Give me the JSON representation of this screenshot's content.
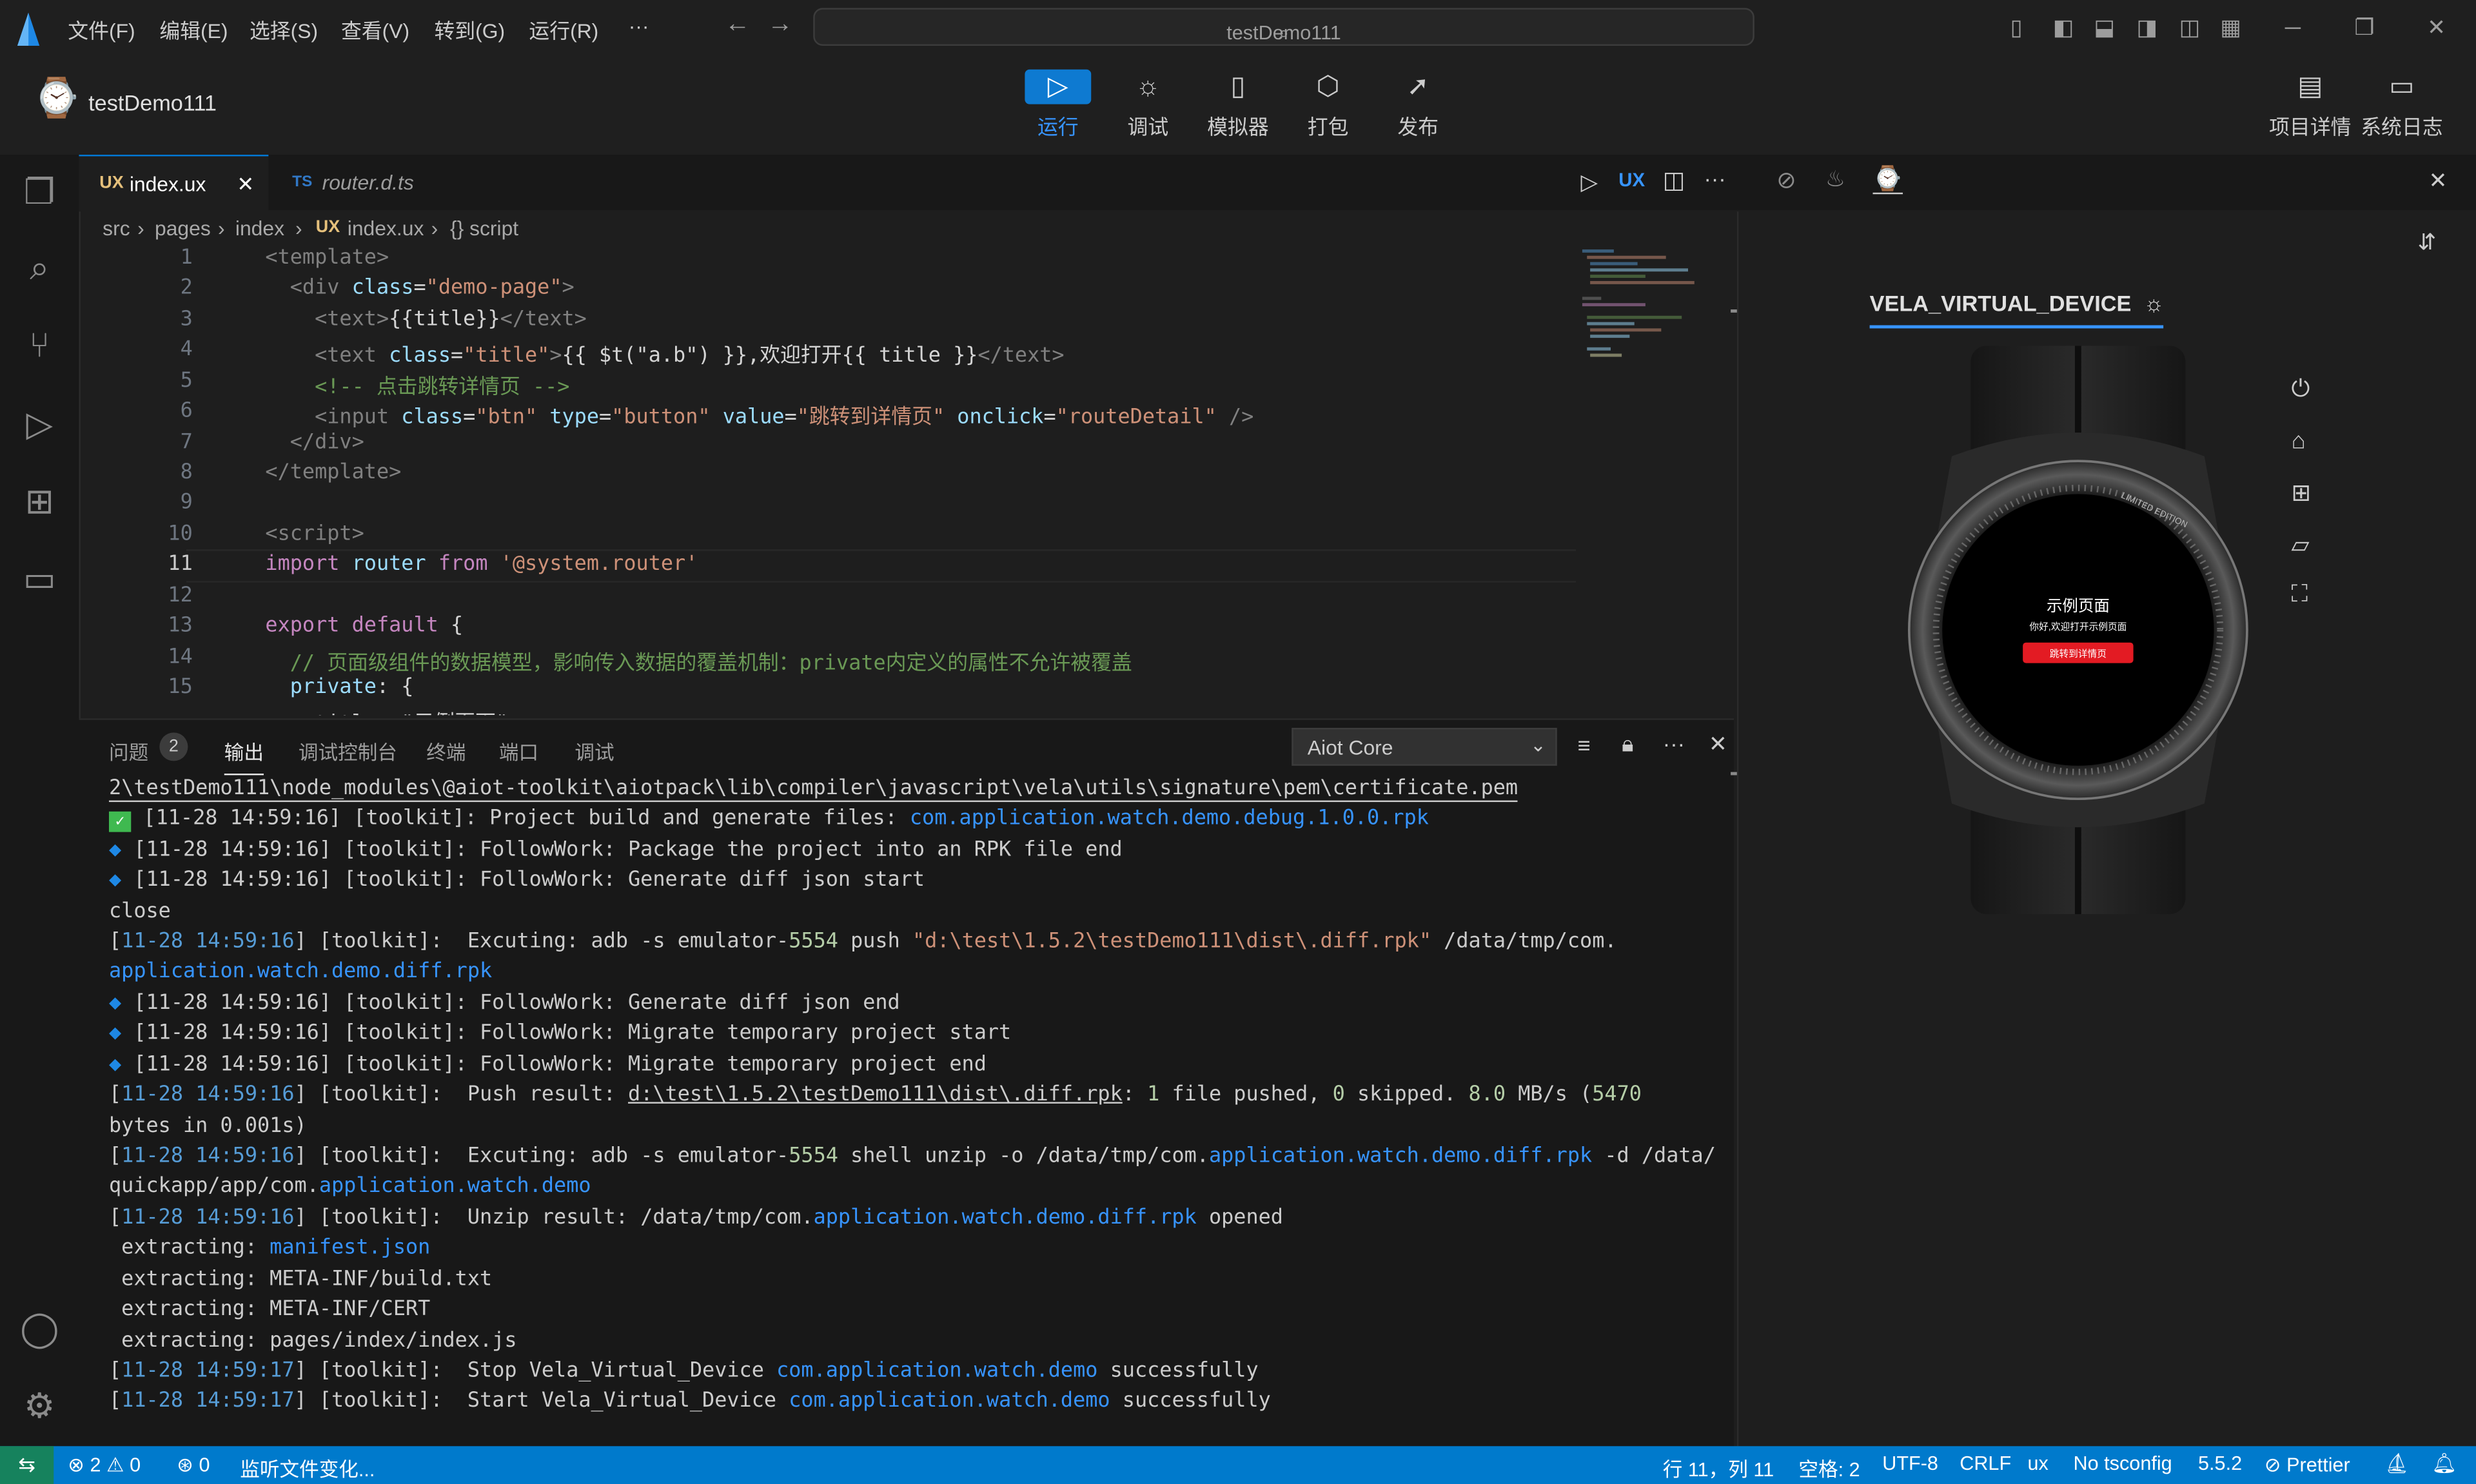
{
  "menu": [
    "文件(F)",
    "编辑(E)",
    "选择(S)",
    "查看(V)",
    "转到(G)",
    "运行(R)",
    "···"
  ],
  "search": {
    "text": "testDemo111"
  },
  "project": {
    "name": "testDemo111"
  },
  "toolbar": {
    "center": [
      {
        "icon": "play-icon",
        "label": "运行"
      },
      {
        "icon": "bug-icon",
        "label": "调试"
      },
      {
        "icon": "phone-icon",
        "label": "模拟器"
      },
      {
        "icon": "package-icon",
        "label": "打包"
      },
      {
        "icon": "send-icon",
        "label": "发布"
      }
    ],
    "right": [
      {
        "icon": "document-icon",
        "label": "项目详情"
      },
      {
        "icon": "folder-icon",
        "label": "系统日志"
      }
    ]
  },
  "tabs": [
    {
      "badge": "UX",
      "label": "index.ux",
      "close": "✕"
    },
    {
      "badge": "TS",
      "label": "router.d.ts"
    }
  ],
  "tab_actions": {
    "ux": "UX"
  },
  "breadcrumb": {
    "p1": "src",
    "p2": "pages",
    "p3": "index",
    "badge": "UX",
    "p4": "index.ux",
    "p5": "{} script"
  },
  "code_lines": [
    "1",
    "2",
    "3",
    "4",
    "5",
    "6",
    "7",
    "8",
    "9",
    "10",
    "11",
    "12",
    "13",
    "14",
    "15"
  ],
  "code": {
    "l1": "<template>",
    "l2a": "  <div ",
    "l2b": "class",
    "l2c": "=",
    "l2d": "\"demo-page\"",
    "l2e": ">",
    "l3a": "    <text>",
    "l3b": "{{title}}",
    "l3c": "</text>",
    "l4a": "    <text ",
    "l4b": "class",
    "l4c": "=",
    "l4d": "\"title\"",
    "l4e": ">",
    "l4f": "{{ $t(\"a.b\") }},欢迎打开{{ title }}",
    "l4g": "</text>",
    "l5": "    <!-- 点击跳转详情页 -->",
    "l6a": "    <input ",
    "l6b": "class",
    "l6d": "\"btn\"",
    "l6e": " type",
    "l6f": "\"button\"",
    "l6g": " value",
    "l6h": "\"跳转到详情页\"",
    "l6i": " onclick",
    "l6j": "\"routeDetail\"",
    "l6k": " />",
    "l7": "  </div>",
    "l8": "</template>",
    "l10": "<script>",
    "l11a": "import",
    "l11b": " router ",
    "l11c": "from",
    "l11d": " '@system.router'",
    "l13a": "export default",
    "l13b": " {",
    "l14": "  // 页面级组件的数据模型，影响传入数据的覆盖机制：private内定义的属性不允许被覆盖",
    "l15a": "  private",
    "l15b": ": {",
    "l16": "    title: \"示例页面\""
  },
  "panel": {
    "tabs": [
      "问题",
      "输出",
      "调试控制台",
      "终端",
      "端口",
      "调试"
    ],
    "problems_count": "2",
    "channel": "Aiot Core",
    "lines": {
      "o1": "2\\testDemo111\\node_modules\\@aiot-toolkit\\aiotpack\\lib\\compiler\\javascript\\vela\\utils\\signature\\pem\\certificate.pem",
      "o2a": " [11-28 14:59:16] [toolkit]: Project build and generate files: ",
      "o2b": "com.application.watch.demo.debug.1.0.0.rpk",
      "o3": " [11-28 14:59:16] [toolkit]: FollowWork: Package the project into an RPK file end",
      "o4": " [11-28 14:59:16] [toolkit]: FollowWork: Generate diff json start",
      "o5": "close",
      "o6a": "[",
      "o6b": "11-28 14:59:16",
      "o6c": "] [toolkit]:  Excuting: adb -s emulator-",
      "o6d": "5554",
      "o6e": " push ",
      "o6f": "\"d:\\test\\1.5.2\\testDemo111\\dist\\.diff.rpk\"",
      "o6g": " /data/tmp/com.",
      "o7": "application.watch.demo.diff.rpk",
      "o8": " [11-28 14:59:16] [toolkit]: FollowWork: Generate diff json end",
      "o9": " [11-28 14:59:16] [toolkit]: FollowWork: Migrate temporary project start",
      "o10": " [11-28 14:59:16] [toolkit]: FollowWork: Migrate temporary project end",
      "o11a": "] [toolkit]:  Push result: ",
      "o11b": "d:\\test\\1.5.2\\testDemo111\\dist\\.diff.rpk",
      "o11c": ": ",
      "o11d": "1",
      "o11e": " file pushed, ",
      "o11f": "0",
      "o11g": " skipped. ",
      "o11h": "8.0",
      "o11i": " MB/s (",
      "o11j": "5470",
      "o12": "bytes in 0.001s)",
      "o13a": "] [toolkit]:  Excuting: adb -s emulator-",
      "o13b": "5554",
      "o13c": " shell unzip -o /data/tmp/com.",
      "o13d": "application.watch.demo.diff.rpk",
      "o13e": " -d /data/",
      "o14a": "quickapp/app/com.",
      "o14b": "application.watch.demo",
      "o15a": "] [toolkit]:  Unzip result: /data/tmp/com.",
      "o15b": "application.watch.demo.diff.rpk",
      "o15c": " opened",
      "o16a": " extracting: ",
      "o16b": "manifest.json",
      "o17": " extracting: META-INF/build.txt",
      "o18": " extracting: META-INF/CERT",
      "o19": " extracting: pages/index/index.js",
      "o20a": "] [toolkit]:  Stop Vela_Virtual_Device ",
      "o20b": "com.application.watch.demo",
      "o20c": " successfully",
      "o21a": "] [toolkit]:  Start Vela_Virtual_Device ",
      "o21b": "com.application.watch.demo",
      "o21c": " successfully",
      "ts16": "11-28 14:59:16",
      "ts17": "11-28 14:59:17"
    }
  },
  "device": {
    "title": "VELA_VIRTUAL_DEVICE",
    "screen_title": "示例页面",
    "screen_sub": "你好,欢迎打开示例页面",
    "screen_button": "跳转到详情页",
    "bezel_top": "LIMITED EDITION"
  },
  "status": {
    "errors": "2",
    "warnings": "0",
    "ports": "0",
    "watching": "监听文件变化...",
    "position": "行 11，列 11",
    "spaces": "空格: 2",
    "encoding": "UTF-8",
    "eol": "CRLF",
    "lang": "ux",
    "tsconfig": "No tsconfig",
    "version": "5.5.2",
    "prettier": "Prettier"
  },
  "colors": {
    "accent": "#007acc",
    "run": "#0e7ad1",
    "screen_button": "#e31b23"
  }
}
